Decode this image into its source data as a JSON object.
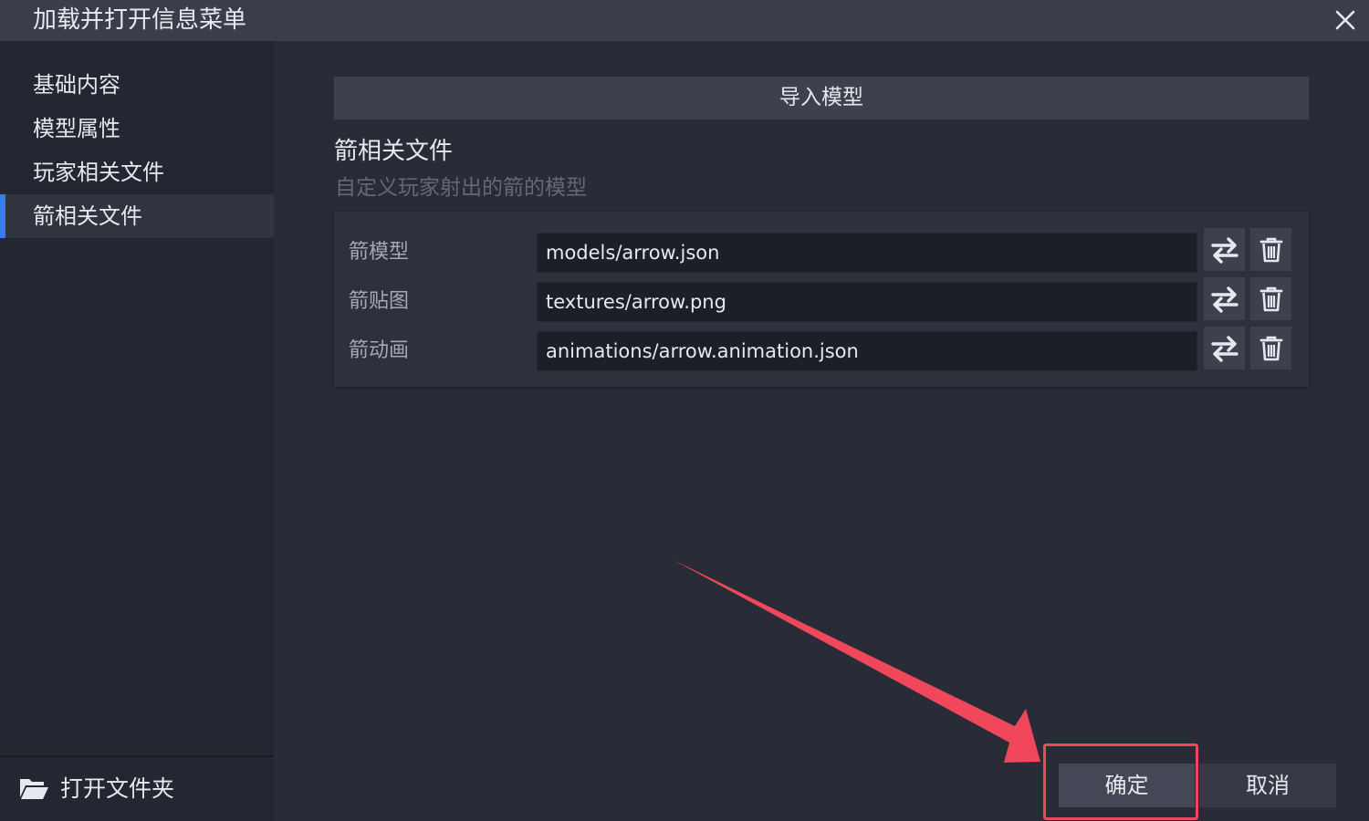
{
  "window": {
    "title": "加载并打开信息菜单",
    "close_icon": "close-icon"
  },
  "sidebar": {
    "items": [
      {
        "label": "基础内容",
        "active": false
      },
      {
        "label": "模型属性",
        "active": false
      },
      {
        "label": "玩家相关文件",
        "active": false
      },
      {
        "label": "箭相关文件",
        "active": true
      }
    ],
    "open_folder": {
      "label": "打开文件夹",
      "icon": "folder-open-icon"
    }
  },
  "main": {
    "import_button": "导入模型",
    "section_title": "箭相关文件",
    "section_description": "自定义玩家射出的箭的模型",
    "rows": [
      {
        "label": "箭模型",
        "value": "models/arrow.json"
      },
      {
        "label": "箭贴图",
        "value": "textures/arrow.png"
      },
      {
        "label": "箭动画",
        "value": "animations/arrow.animation.json"
      }
    ]
  },
  "footer": {
    "ok_label": "确定",
    "cancel_label": "取消"
  },
  "colors": {
    "accent": "#3a7cf0",
    "annotation": "#f0475a",
    "background": "#292c37",
    "sidebar": "#242731",
    "titlebar": "#3a3e4b"
  }
}
